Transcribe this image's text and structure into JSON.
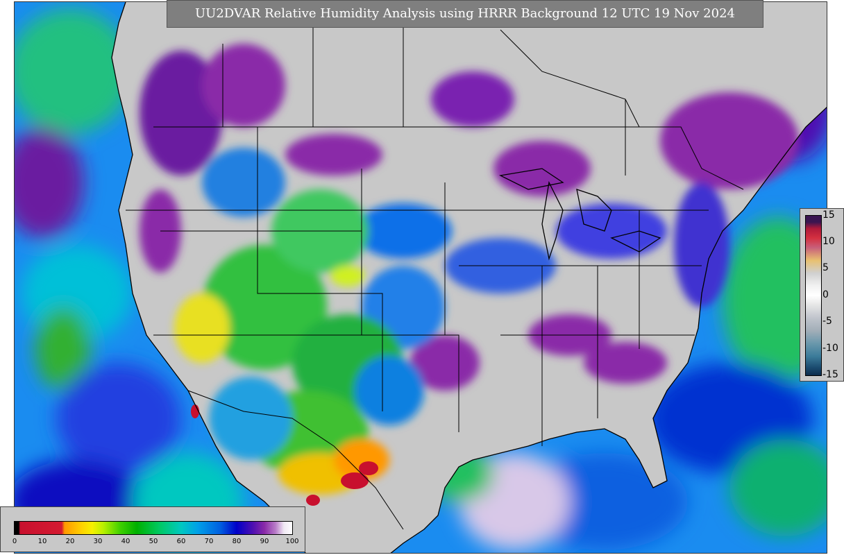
{
  "title": "UU2DVAR Relative Humidity Analysis using HRRR Background 12 UTC 19 Nov 2024",
  "rh_legend": {
    "ticks": [
      "0",
      "10",
      "20",
      "30",
      "40",
      "50",
      "60",
      "70",
      "80",
      "90",
      "100"
    ]
  },
  "diff_legend": {
    "ticks": [
      "15",
      "10",
      "5",
      "0",
      "-5",
      "-10",
      "-15"
    ]
  },
  "colors": {
    "land_dry": "#c8c8c8",
    "ocean_blue": "#0080ff",
    "moist_purple": "#8a2aa8",
    "dry_yellow": "#f0e000",
    "very_dry_red": "#c8102e",
    "green": "#20c020",
    "border": "#000000"
  }
}
